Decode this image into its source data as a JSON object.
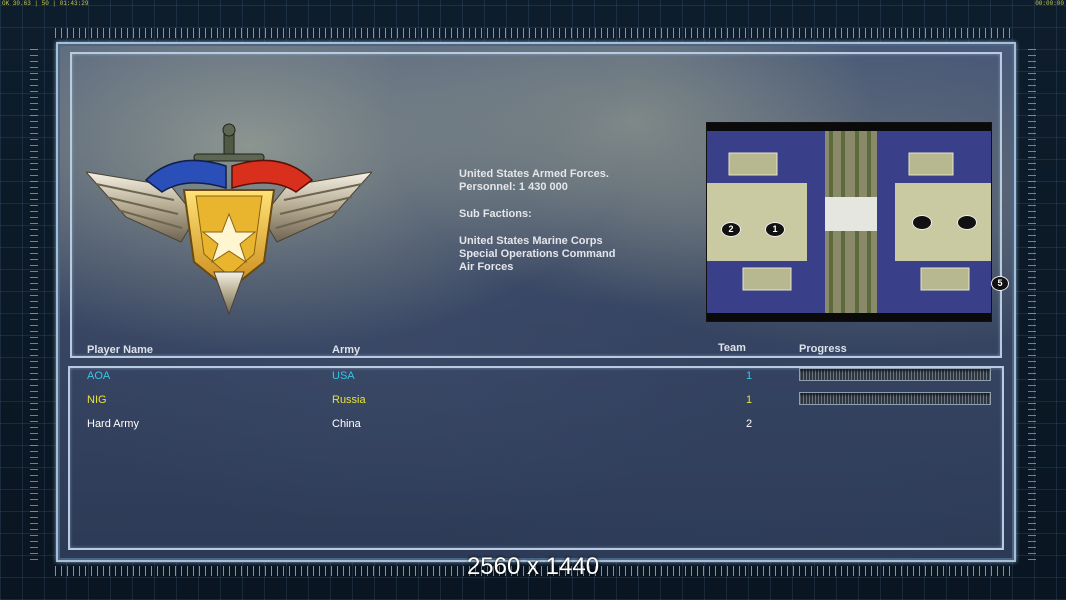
{
  "status_bar": {
    "left": "OK 30.63 | 50 | 01:43:29",
    "right": "00:00:00"
  },
  "faction": {
    "name": "United States Armed Forces.",
    "personnel": "Personnel: 1 430 000",
    "sub_factions_label": "Sub Factions:",
    "sub_factions": [
      "United States Marine Corps",
      "Special Operations Command",
      "Air Forces"
    ]
  },
  "minimap": {
    "start_markers": [
      "2",
      "1",
      "",
      ""
    ],
    "outside_marker": "5"
  },
  "table": {
    "headers": {
      "player": "Player Name",
      "army": "Army",
      "team": "Team",
      "progress": "Progress"
    },
    "rows": [
      {
        "player": "AOA",
        "army": "USA",
        "team": "1",
        "color": "#33c8e8",
        "has_progress": true
      },
      {
        "player": "NIG",
        "army": "Russia",
        "team": "1",
        "color": "#e6e23a",
        "has_progress": true
      },
      {
        "player": "Hard Army",
        "army": "China",
        "team": "2",
        "color": "#ffffff",
        "has_progress": false
      }
    ]
  },
  "resolution_label": "2560 x 1440",
  "colors": {
    "frame_border": "#a8bed4",
    "emblem_blue": "#2a4fb8",
    "emblem_red": "#d8301c",
    "emblem_gold": "#f2c437",
    "map_water": "#3a3f8a",
    "map_land": "#c9c9a2"
  }
}
